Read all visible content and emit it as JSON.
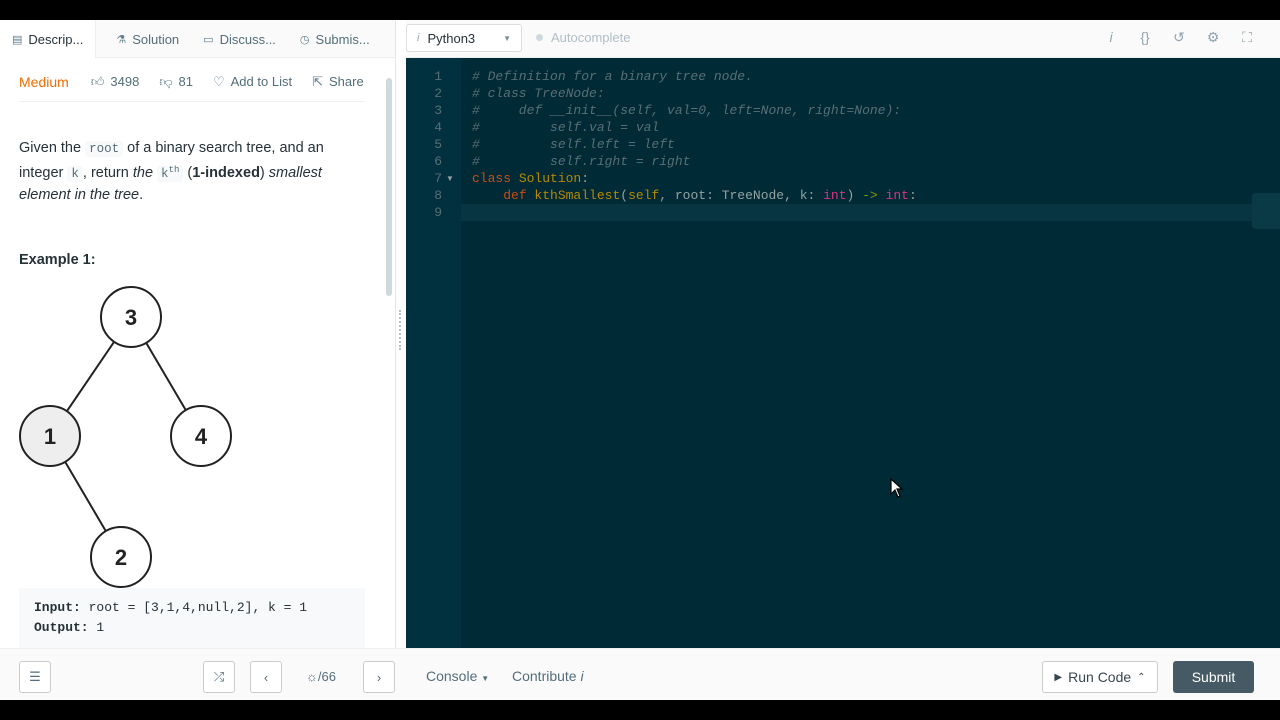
{
  "tabs": [
    {
      "label": "Descrip...",
      "icon": "description-icon"
    },
    {
      "label": "Solution",
      "icon": "flask-icon"
    },
    {
      "label": "Discuss...",
      "icon": "comment-icon"
    },
    {
      "label": "Submis...",
      "icon": "clock-icon"
    }
  ],
  "problem": {
    "difficulty": "Medium",
    "likes": "3498",
    "dislikes": "81",
    "add_to_list": "Add to List",
    "share": "Share",
    "desc_1": "Given the ",
    "desc_root": "root",
    "desc_2": " of a binary search tree, and an integer ",
    "desc_k": "k",
    "desc_3": ", return ",
    "desc_the": "the ",
    "desc_kth": "k",
    "desc_th": "th",
    "desc_indexed": "1-indexed",
    "desc_smallest": "smallest element in the tree",
    "desc_end": ".",
    "example_title": "Example 1:",
    "tree_nodes": [
      "3",
      "1",
      "4",
      "2"
    ],
    "input_label": "Input:",
    "input_value": " root = [3,1,4,null,2], k = 1",
    "output_label": "Output:",
    "output_value": " 1"
  },
  "editor": {
    "language": "Python3",
    "autocomplete": "Autocomplete",
    "line_numbers": [
      "1",
      "2",
      "3",
      "4",
      "5",
      "6",
      "7",
      "8",
      "9"
    ],
    "lines": {
      "l1": "# Definition for a binary tree node.",
      "l2": "# class TreeNode:",
      "l3": "#     def __init__(self, val=0, left=None, right=None):",
      "l4": "#         self.val = val",
      "l5": "#         self.left = left",
      "l6": "#         self.right = right",
      "l7_kw": "class",
      "l7_name": " Solution",
      "l7_colon": ":",
      "l8_indent": "    ",
      "l8_def": "def",
      "l8_fn": " kthSmallest",
      "l8_open": "(",
      "l8_self": "self",
      "l8_mid": ", root: TreeNode, k: ",
      "l8_int1": "int",
      "l8_close": ") ",
      "l8_arrow": "->",
      "l8_sp": " ",
      "l8_int2": "int",
      "l8_end": ":"
    },
    "toolbar": [
      "info-icon",
      "braces-icon",
      "reset-icon",
      "settings-icon",
      "fullscreen-icon"
    ]
  },
  "bottom": {
    "pager": "/66",
    "console": "Console",
    "contribute": "Contribute",
    "run": "Run Code",
    "submit": "Submit"
  }
}
